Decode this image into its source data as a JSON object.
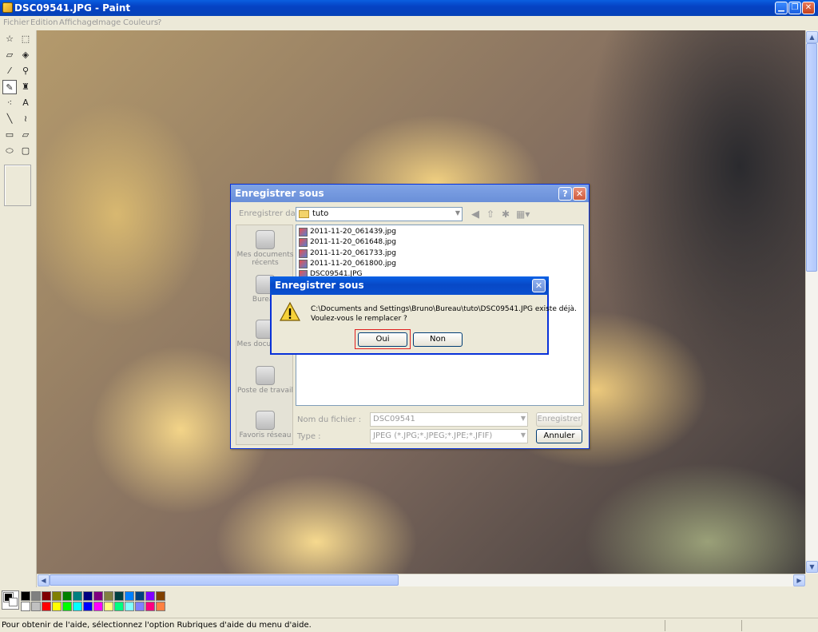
{
  "window": {
    "title": "DSC09541.JPG - Paint"
  },
  "menu": [
    "Fichier",
    "Edition",
    "Affichage",
    "Image",
    "Couleurs",
    "?"
  ],
  "tools": [
    {
      "name": "free-select-icon",
      "glyph": "☆"
    },
    {
      "name": "rect-select-icon",
      "glyph": "⬚"
    },
    {
      "name": "eraser-icon",
      "glyph": "▱"
    },
    {
      "name": "fill-icon",
      "glyph": "◈"
    },
    {
      "name": "color-picker-icon",
      "glyph": "⁄"
    },
    {
      "name": "magnifier-icon",
      "glyph": "⚲"
    },
    {
      "name": "pencil-icon",
      "glyph": "✎"
    },
    {
      "name": "brush-icon",
      "glyph": "♜"
    },
    {
      "name": "airbrush-icon",
      "glyph": "⁖"
    },
    {
      "name": "text-icon",
      "glyph": "A"
    },
    {
      "name": "line-icon",
      "glyph": "╲"
    },
    {
      "name": "curve-icon",
      "glyph": "≀"
    },
    {
      "name": "rectangle-icon",
      "glyph": "▭"
    },
    {
      "name": "polygon-icon",
      "glyph": "▱"
    },
    {
      "name": "ellipse-icon",
      "glyph": "⬭"
    },
    {
      "name": "rounded-rect-icon",
      "glyph": "▢"
    }
  ],
  "palette": {
    "top": [
      "#000000",
      "#808080",
      "#800000",
      "#808000",
      "#008000",
      "#008080",
      "#000080",
      "#800080",
      "#808040",
      "#004040",
      "#0080ff",
      "#004080",
      "#8000ff",
      "#804000"
    ],
    "bottom": [
      "#ffffff",
      "#c0c0c0",
      "#ff0000",
      "#ffff00",
      "#00ff00",
      "#00ffff",
      "#0000ff",
      "#ff00ff",
      "#ffff80",
      "#00ff80",
      "#80ffff",
      "#8080ff",
      "#ff0080",
      "#ff8040"
    ]
  },
  "status": {
    "text": "Pour obtenir de l'aide, sélectionnez l'option Rubriques d'aide du menu d'aide."
  },
  "save_dialog": {
    "title": "Enregistrer sous",
    "save_in_label": "Enregistrer dans :",
    "folder": "tuto",
    "places": [
      "Mes documents récents",
      "Bureau",
      "Mes documents",
      "Poste de travail",
      "Favoris réseau"
    ],
    "files": [
      "2011-11-20_061439.jpg",
      "2011-11-20_061648.jpg",
      "2011-11-20_061733.jpg",
      "2011-11-20_061800.jpg",
      "DSC09541.JPG"
    ],
    "filename_label": "Nom du fichier :",
    "filename": "DSC09541",
    "type_label": "Type :",
    "type": "JPEG (*.JPG;*.JPEG;*.JPE;*.JFIF)",
    "save_button": "Enregistrer",
    "cancel_button": "Annuler"
  },
  "confirm_dialog": {
    "title": "Enregistrer sous",
    "message_line1": "C:\\Documents and Settings\\Bruno\\Bureau\\tuto\\DSC09541.JPG existe déjà.",
    "message_line2": "Voulez-vous le remplacer ?",
    "yes_button": "Oui",
    "no_button": "Non"
  }
}
